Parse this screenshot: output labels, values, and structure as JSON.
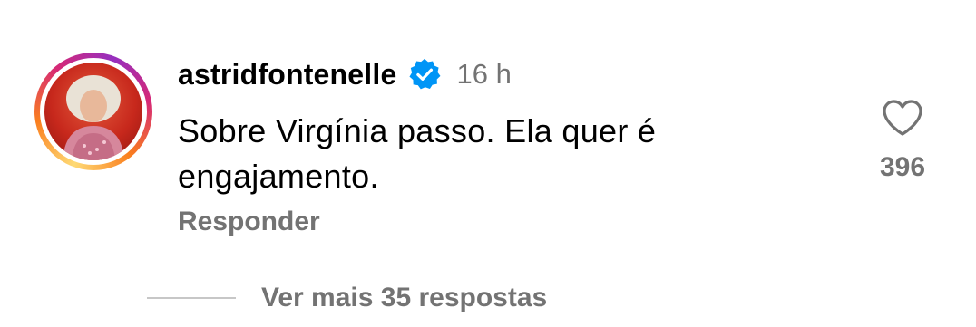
{
  "comment": {
    "username": "astridfontenelle",
    "verified_icon": "verified-badge-icon",
    "time": "16 h",
    "text_line1": "Sobre Virgínia passo. Ela quer é",
    "text_line2": "engajamento.",
    "reply_label": "Responder",
    "like_icon": "heart-outline-icon",
    "like_count": "396"
  },
  "replies": {
    "view_more_label": "Ver mais 35 respostas"
  },
  "colors": {
    "verified_blue": "#0095f6",
    "secondary_text": "#737373",
    "story_ring": [
      "#feda75",
      "#fa7e1e",
      "#d62976",
      "#962fbf"
    ]
  }
}
